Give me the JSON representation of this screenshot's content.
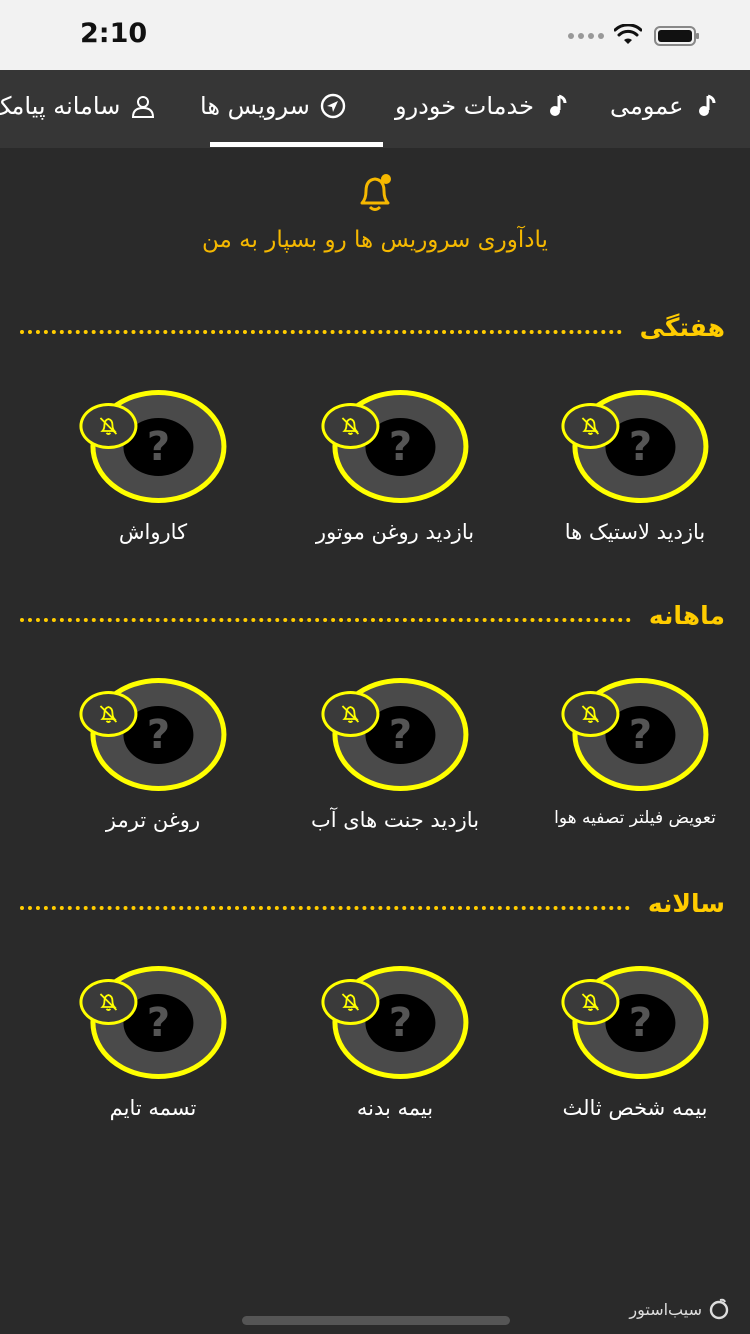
{
  "status_bar": {
    "time": "2:10",
    "icons": [
      "signal-dots-icon",
      "wifi-icon",
      "battery-icon"
    ]
  },
  "tabs": [
    {
      "label": "عمومی",
      "icon": "music-note-icon"
    },
    {
      "label": "خدمات خودرو",
      "icon": "music-note-icon"
    },
    {
      "label": "سرویس ها",
      "icon": "navigation-arrow-icon",
      "selected": true
    },
    {
      "label": "سامانه پیامک",
      "icon": "user-icon"
    }
  ],
  "reminder": {
    "icon": "bell-icon",
    "text": "یادآوری سروریس ها رو بسپار به من"
  },
  "sections": [
    {
      "title": "هفتگی",
      "items": [
        {
          "label": "بازدید لاستیک ها"
        },
        {
          "label": "بازدید روغن موتور"
        },
        {
          "label": "کارواش"
        }
      ]
    },
    {
      "title": "ماهانه",
      "items": [
        {
          "label": "تعویض فیلتر تصفیه هوا"
        },
        {
          "label": "بازدید جنت های آب"
        },
        {
          "label": "روغن ترمز"
        }
      ]
    },
    {
      "title": "سالانه",
      "items": [
        {
          "label": "بیمه شخص ثالث"
        },
        {
          "label": "بیمه بدنه"
        },
        {
          "label": "تسمه تایم"
        }
      ]
    }
  ],
  "service_placeholder": "?",
  "item_icons": {
    "badge": "bell-off-icon"
  },
  "watermark": "سیب‌استور",
  "colors": {
    "background": "#2a2a2a",
    "accent": "#ffff00",
    "title": "#ffcc00",
    "reminder_text": "#f5b800"
  }
}
